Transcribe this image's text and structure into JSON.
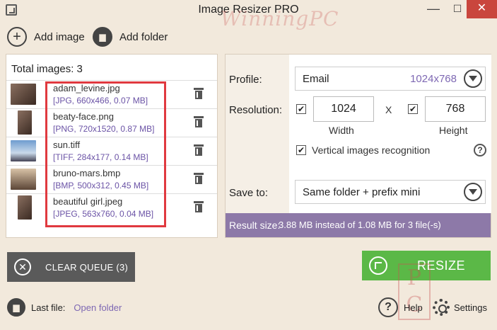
{
  "window": {
    "title": "Image Resizer PRO",
    "watermark": "WinningPC"
  },
  "toolbar": {
    "add_image": "Add image",
    "add_folder": "Add folder"
  },
  "queue": {
    "total_label": "Total images: 3",
    "files": [
      {
        "name": "adam_levine.jpg",
        "info": "[JPG, 660x466, 0.07 MB]"
      },
      {
        "name": "beaty-face.png",
        "info": "[PNG, 720x1520, 0.87 MB]"
      },
      {
        "name": "sun.tiff",
        "info": "[TIFF, 284x177, 0.14 MB]"
      },
      {
        "name": "bruno-mars.bmp",
        "info": "[BMP, 500x312, 0.45 MB]"
      },
      {
        "name": "beautiful girl.jpeg",
        "info": "[JPEG, 563x760, 0.04 MB]"
      }
    ]
  },
  "settings": {
    "profile_label": "Profile:",
    "profile_value": "Email",
    "profile_size": "1024x768",
    "resolution_label": "Resolution:",
    "width_value": "1024",
    "height_value": "768",
    "x_sep": "X",
    "width_label": "Width",
    "height_label": "Height",
    "vertical_label": "Vertical images recognition",
    "save_label": "Save to:",
    "save_value": "Same folder + prefix mini",
    "result_label": "Result size:",
    "result_value": "3.88 MB instead of 1.08 MB for 3 file(-s)"
  },
  "actions": {
    "clear_queue": "CLEAR QUEUE (3)",
    "resize": "RESIZE"
  },
  "footer": {
    "last_file_label": "Last file:",
    "open_folder": "Open folder",
    "help": "Help",
    "settings": "Settings"
  },
  "icons": {
    "checkmark": "✔",
    "close": "✕",
    "minimize": "—",
    "maximize": "☐",
    "plus": "+",
    "question": "?"
  },
  "colors": {
    "background": "#f2e9dc",
    "accent_purple": "#8d79a8",
    "resize_green": "#5bb847",
    "clear_gray": "#5a5a5a",
    "highlight_red": "#e0393f"
  }
}
